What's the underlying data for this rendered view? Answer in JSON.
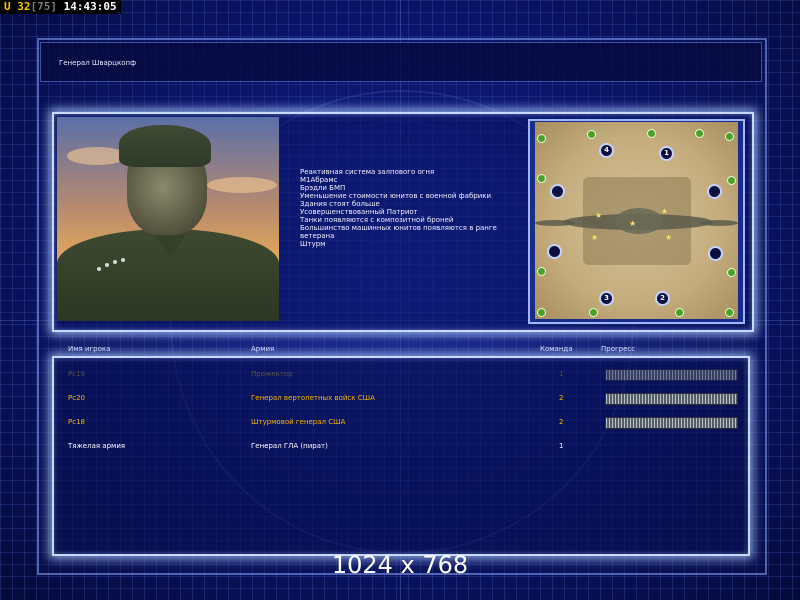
{
  "hud": {
    "u_label": "U",
    "u_value": "32",
    "bracket_value": "[75]",
    "time": "14:43:05"
  },
  "header": {
    "title": "Генерал Шварцкопф"
  },
  "general": {
    "portrait_icon": "general-portrait",
    "features": [
      "Реактивная система залпового огня",
      "M1Абрамс",
      "Брэдли БМП",
      "Уменьшение стоимости юнитов с военной фабрики",
      "Здания стоят больше",
      "Усовершенствованный Патриот",
      "Танки появляются с композитной броней",
      "Большинство машинных юнитов появляются в ранге ветерана",
      "Штурм"
    ]
  },
  "map": {
    "start_positions": [
      "1",
      "2",
      "3",
      "4"
    ]
  },
  "columns": {
    "player": "Имя игрока",
    "army": "Армия",
    "team": "Команда",
    "progress": "Прогресс"
  },
  "players": [
    {
      "name": "Pc19",
      "army": "Прожектор",
      "team": "1",
      "progress": 1.0,
      "style": "dim"
    },
    {
      "name": "Pc20",
      "army": "Генерал вертолетных войск США",
      "team": "2",
      "progress": 1.0,
      "style": "orange"
    },
    {
      "name": "Pc18",
      "army": "Штурмовой генерал США",
      "team": "2",
      "progress": 1.0,
      "style": "orange"
    },
    {
      "name": "Тяжелая армия",
      "army": "Генерал ГЛА (пират)",
      "team": "1",
      "progress": null,
      "style": "white"
    }
  ],
  "footer": {
    "resolution": "1024 x 768"
  },
  "colors": {
    "accent_orange": "#f7b400",
    "panel_glow": "#c8d8ff",
    "background": "#0c1670"
  }
}
